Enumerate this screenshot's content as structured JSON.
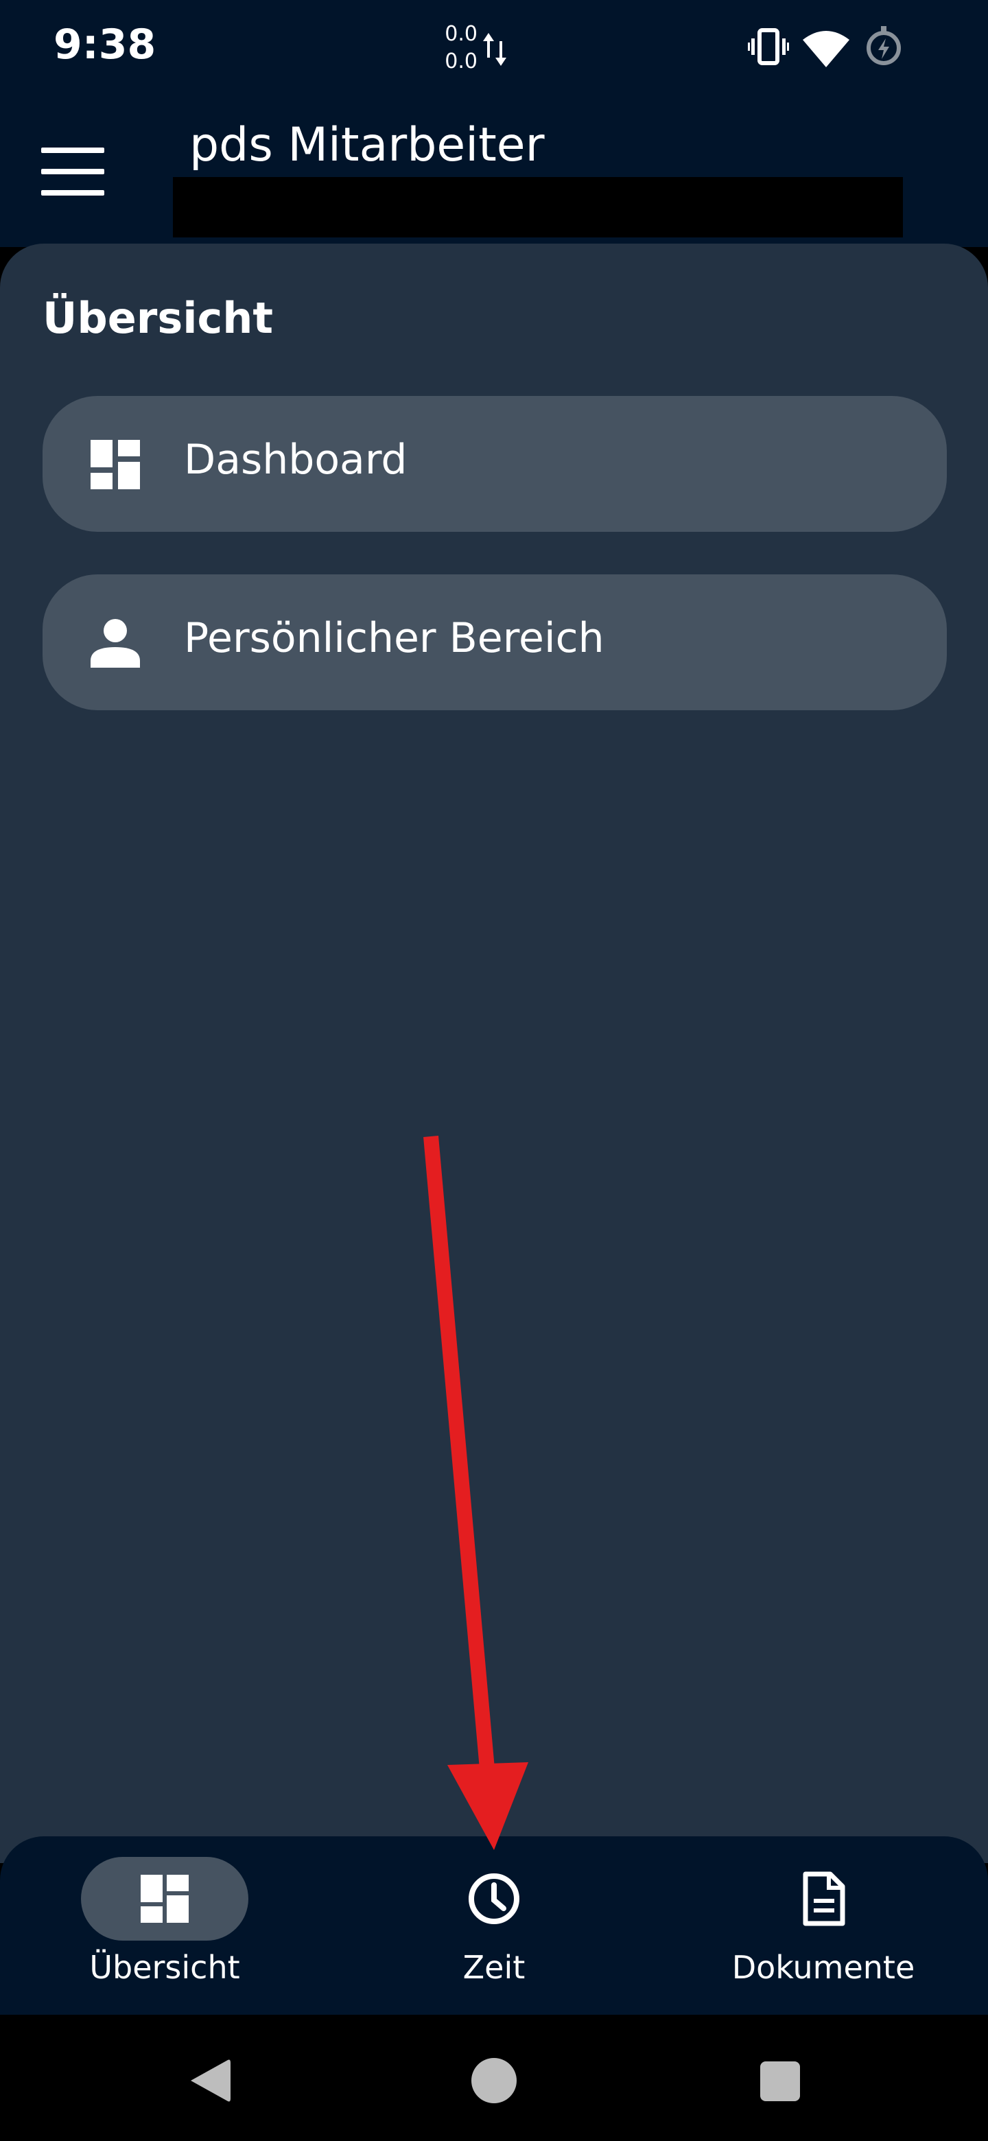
{
  "status_bar": {
    "time": "9:38",
    "net_up": "0.0",
    "net_down": "0.0",
    "icons": [
      "data-transfer-icon",
      "vibrate-icon",
      "wifi-icon",
      "battery-saver-icon"
    ]
  },
  "app_bar": {
    "title": "pds Mitarbeiter",
    "menu_icon": "hamburger-menu-icon"
  },
  "main": {
    "section_title": "Übersicht",
    "items": [
      {
        "label": "Dashboard",
        "icon": "dashboard-icon"
      },
      {
        "label": "Persönlicher Bereich",
        "icon": "person-icon"
      }
    ]
  },
  "bottom_nav": {
    "items": [
      {
        "label": "Übersicht",
        "icon": "dashboard-icon",
        "active": true
      },
      {
        "label": "Zeit",
        "icon": "clock-icon",
        "active": false
      },
      {
        "label": "Dokumente",
        "icon": "document-icon",
        "active": false
      }
    ]
  },
  "system_nav": [
    "back-icon",
    "home-icon",
    "recents-icon"
  ],
  "colors": {
    "top_bar": "#01142a",
    "sheet": "#233243",
    "card": "#465361",
    "annotation_arrow": "#e41e20"
  }
}
